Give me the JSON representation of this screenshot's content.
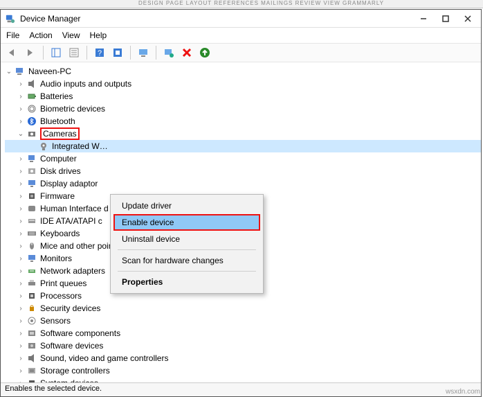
{
  "ribbon_hint": "DESIGN     PAGE LAYOUT     REFERENCES     MAILINGS     REVIEW     VIEW     GRAMMARLY",
  "window": {
    "title": "Device Manager"
  },
  "menubar": {
    "file": "File",
    "action": "Action",
    "view": "View",
    "help": "Help"
  },
  "toolbar_icons": {
    "back": "back-arrow",
    "fwd": "forward-arrow",
    "dock": "show-hidden",
    "properties": "properties",
    "help": "help",
    "refresh": "refresh",
    "update": "update-driver",
    "scan": "scan-hardware",
    "uninstall": "uninstall",
    "enable": "enable"
  },
  "tree": {
    "root": "Naveen-PC",
    "items": [
      {
        "label": "Audio inputs and outputs",
        "expand": ">",
        "icon": "speaker"
      },
      {
        "label": "Batteries",
        "expand": ">",
        "icon": "battery"
      },
      {
        "label": "Biometric devices",
        "expand": ">",
        "icon": "fingerprint"
      },
      {
        "label": "Bluetooth",
        "expand": ">",
        "icon": "bluetooth"
      },
      {
        "label": "Cameras",
        "expand": "v",
        "icon": "camera",
        "highlight": true,
        "children": [
          {
            "label": "Integrated W…",
            "icon": "webcam",
            "selected": true
          }
        ]
      },
      {
        "label": "Computer",
        "expand": ">",
        "icon": "pc"
      },
      {
        "label": "Disk drives",
        "expand": ">",
        "icon": "disk"
      },
      {
        "label": "Display adaptor",
        "expand": ">",
        "icon": "display"
      },
      {
        "label": "Firmware",
        "expand": ">",
        "icon": "chip"
      },
      {
        "label": "Human Interface d",
        "expand": ">",
        "icon": "hid"
      },
      {
        "label": "IDE ATA/ATAPI c",
        "expand": ">",
        "icon": "ide"
      },
      {
        "label": "Keyboards",
        "expand": ">",
        "icon": "keyboard"
      },
      {
        "label": "Mice and other pointing devices",
        "expand": ">",
        "icon": "mouse"
      },
      {
        "label": "Monitors",
        "expand": ">",
        "icon": "monitor"
      },
      {
        "label": "Network adapters",
        "expand": ">",
        "icon": "network"
      },
      {
        "label": "Print queues",
        "expand": ">",
        "icon": "printer"
      },
      {
        "label": "Processors",
        "expand": ">",
        "icon": "cpu"
      },
      {
        "label": "Security devices",
        "expand": ">",
        "icon": "security"
      },
      {
        "label": "Sensors",
        "expand": ">",
        "icon": "sensor"
      },
      {
        "label": "Software components",
        "expand": ">",
        "icon": "swc"
      },
      {
        "label": "Software devices",
        "expand": ">",
        "icon": "swd"
      },
      {
        "label": "Sound, video and game controllers",
        "expand": ">",
        "icon": "sound"
      },
      {
        "label": "Storage controllers",
        "expand": ">",
        "icon": "storage"
      },
      {
        "label": "System devices",
        "expand": ">",
        "icon": "system"
      }
    ]
  },
  "context_menu": {
    "update": "Update driver",
    "enable": "Enable device",
    "uninstall": "Uninstall device",
    "scan": "Scan for hardware changes",
    "properties": "Properties"
  },
  "statusbar": "Enables the selected device.",
  "watermark": "wsxdn.com"
}
